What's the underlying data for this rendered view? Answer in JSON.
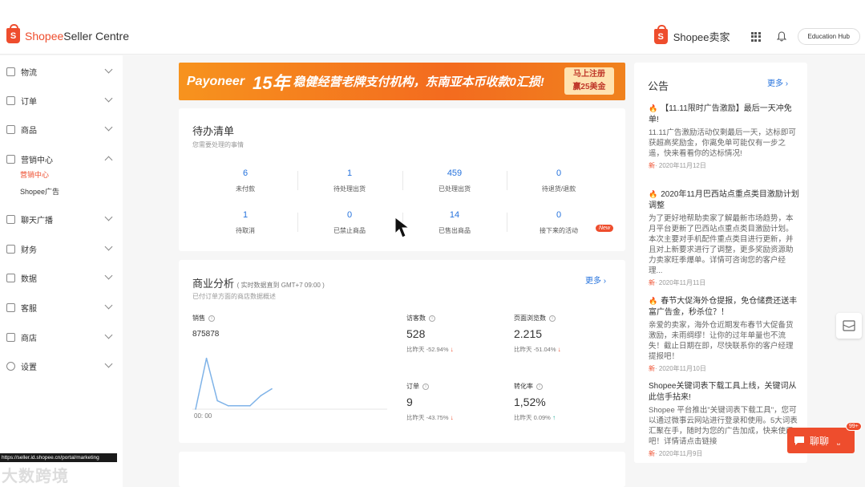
{
  "header": {
    "logo_shopee": "Shopee",
    "logo_suffix": " Seller Centre",
    "shop_cn": "Shopee卖家",
    "edu_hub": "Education Hub"
  },
  "sidebar": {
    "items": [
      {
        "label": "物流",
        "icon": "truck-icon"
      },
      {
        "label": "订单",
        "icon": "order-icon"
      },
      {
        "label": "商品",
        "icon": "product-icon"
      },
      {
        "label": "营销中心",
        "icon": "tag-icon"
      },
      {
        "label": "聊天广播",
        "icon": "broadcast-icon"
      },
      {
        "label": "财务",
        "icon": "wallet-icon"
      },
      {
        "label": "数据",
        "icon": "chart-icon"
      },
      {
        "label": "客服",
        "icon": "support-icon"
      },
      {
        "label": "商店",
        "icon": "shop-icon"
      },
      {
        "label": "设置",
        "icon": "gear-icon"
      }
    ],
    "sub_marketing": "营销中心",
    "sub_ads": "Shopee广告"
  },
  "banner": {
    "brand": "Payoneer",
    "years": "15年",
    "slogan": "稳健经营老牌支付机构，东南亚本币收款0汇损!",
    "cta_line1": "马上注册",
    "cta_line2": "赢25美金"
  },
  "todo": {
    "title": "待办清单",
    "subtitle": "您需要处理的事情",
    "stats": [
      {
        "value": "6",
        "label": "未付款"
      },
      {
        "value": "1",
        "label": "待处理出货"
      },
      {
        "value": "459",
        "label": "已处理出货"
      },
      {
        "value": "0",
        "label": "待退货/退款"
      },
      {
        "value": "1",
        "label": "待取消"
      },
      {
        "value": "0",
        "label": "已禁止商品"
      },
      {
        "value": "14",
        "label": "已售出商品"
      },
      {
        "value": "0",
        "label": "接下来的活动"
      }
    ],
    "new_badge": "New"
  },
  "biz": {
    "title": "商业分析",
    "title_note": "( 实时数据直到 GMT+7 09:00 )",
    "subtitle": "已付订单方面的商店数据概述",
    "more": "更多",
    "sales_label": "销售",
    "sales_value": "875878",
    "chart_time": "00: 00",
    "metrics": [
      {
        "label": "访客数",
        "value": "528",
        "cmp": "比昨天 -52.94%",
        "dir": "down"
      },
      {
        "label": "页面浏览数",
        "value": "2.215",
        "cmp": "比昨天 -51.04%",
        "dir": "down"
      },
      {
        "label": "订单",
        "value": "9",
        "cmp": "比昨天 -43.75%",
        "dir": "down"
      },
      {
        "label": "转化率",
        "value": "1,52%",
        "cmp": "比昨天 0.09%",
        "dir": "up"
      }
    ]
  },
  "chart_data": {
    "type": "line",
    "series": [
      {
        "values": [
          0,
          30,
          5,
          2,
          2,
          2,
          8,
          12
        ]
      }
    ],
    "ylim": [
      0,
      35
    ]
  },
  "notice": {
    "title": "公告",
    "more": "更多",
    "items": [
      {
        "hot": true,
        "title": "【11.11限时广告激励】最后一天冲免单!",
        "body": "11.11广告激励活动仅剩最后一天，达标即可获超高奖励金，你离免单可能仅有一步之遥，快来看看你的达标情况!",
        "new": "新",
        "date": "· 2020年11月12日"
      },
      {
        "hot": true,
        "title": "2020年11月巴西站点重点类目激励计划调整",
        "body": "为了更好地帮助卖家了解最新市场趋势，本月平台更新了巴西站点重点类目激励计划。本次主要对手机配件重点类目进行更新，并且对上新要求进行了调整，更多奖励资源助力卖家旺季爆单。详情可咨询您的客户经理...",
        "new": "新",
        "date": "· 2020年11月11日"
      },
      {
        "hot": true,
        "title": "春节大促海外仓提报，免仓储费还送丰富广告金，秒杀位？！",
        "body": "亲爱的卖家，海外仓近期发布春节大促备货激励，未雨绸缪！让你的过年单量也不流失！截止日期在即，尽快联系你的客户经理提报吧！",
        "new": "新",
        "date": "· 2020年11月10日"
      },
      {
        "hot": false,
        "title": "Shopee关键词表下载工具上线，关键词从此信手拈来!",
        "body": "Shopee 平台推出\"关键词表下载工具\"，您可以通过微事云网站进行登录和使用。5大词表汇聚在手，随时为您的广告加成，快来使用吧！详情请点击链接",
        "new": "新",
        "date": "· 2020年11月9日"
      }
    ]
  },
  "chat": {
    "label": "聊聊",
    "badge": "99+"
  },
  "url": "https://seller.id.shopee.cn/portal/marketing",
  "watermark": "大数跨境",
  "colors": {
    "brand": "#ee4d2d",
    "link": "#2673dd",
    "chart_line": "#7fb3e8"
  }
}
